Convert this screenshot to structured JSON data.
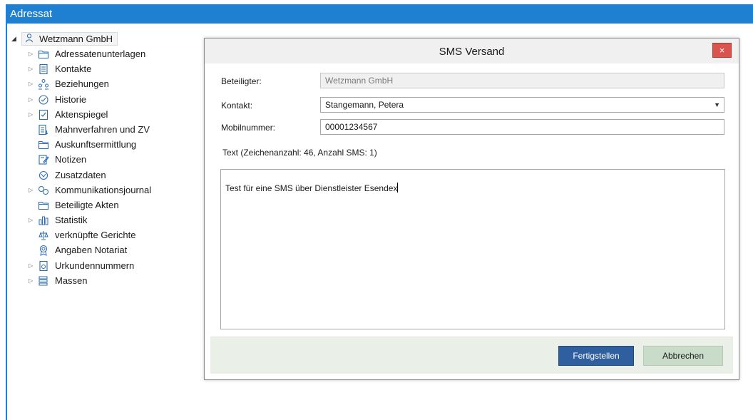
{
  "window": {
    "title": "Adressat"
  },
  "tree": {
    "root": {
      "label": "Wetzmann GmbH"
    },
    "items": [
      {
        "label": "Adressatenunterlagen",
        "expandable": true,
        "icon": "folder-icon"
      },
      {
        "label": "Kontakte",
        "expandable": true,
        "icon": "contacts-icon"
      },
      {
        "label": "Beziehungen",
        "expandable": true,
        "icon": "relations-icon"
      },
      {
        "label": "Historie",
        "expandable": true,
        "icon": "history-icon"
      },
      {
        "label": "Aktenspiegel",
        "expandable": true,
        "icon": "checklist-icon"
      },
      {
        "label": "Mahnverfahren und ZV",
        "expandable": false,
        "icon": "document-list-icon"
      },
      {
        "label": "Auskunftsermittlung",
        "expandable": false,
        "icon": "folder-icon"
      },
      {
        "label": "Notizen",
        "expandable": false,
        "icon": "notes-icon"
      },
      {
        "label": "Zusatzdaten",
        "expandable": false,
        "icon": "extra-data-icon"
      },
      {
        "label": "Kommunikationsjournal",
        "expandable": true,
        "icon": "communication-icon"
      },
      {
        "label": "Beteiligte Akten",
        "expandable": false,
        "icon": "folder-icon"
      },
      {
        "label": "Statistik",
        "expandable": true,
        "icon": "bar-chart-icon"
      },
      {
        "label": "verknüpfte Gerichte",
        "expandable": false,
        "icon": "court-icon"
      },
      {
        "label": "Angaben Notariat",
        "expandable": false,
        "icon": "seal-icon"
      },
      {
        "label": "Urkundennummern",
        "expandable": true,
        "icon": "certificate-icon"
      },
      {
        "label": "Massen",
        "expandable": true,
        "icon": "stack-icon"
      }
    ]
  },
  "dialog": {
    "title": "SMS Versand",
    "close_glyph": "×",
    "beteiligter": {
      "label": "Beteiligter:",
      "value": "Wetzmann GmbH"
    },
    "kontakt": {
      "label": "Kontakt:",
      "value": "Stangemann, Petera"
    },
    "mobilnummer": {
      "label": "Mobilnummer:",
      "value": "00001234567"
    },
    "text_info": "Text (Zeichenanzahl: 46, Anzahl SMS: 1)",
    "message": "Test für eine SMS über Dienstleister Esendex",
    "finish_label": "Fertigstellen",
    "cancel_label": "Abbrechen"
  },
  "colors": {
    "titlebar": "#1f7fd0",
    "primary_button": "#2f5f9e",
    "secondary_button": "#c9dcc9",
    "close_button": "#d9534f"
  }
}
